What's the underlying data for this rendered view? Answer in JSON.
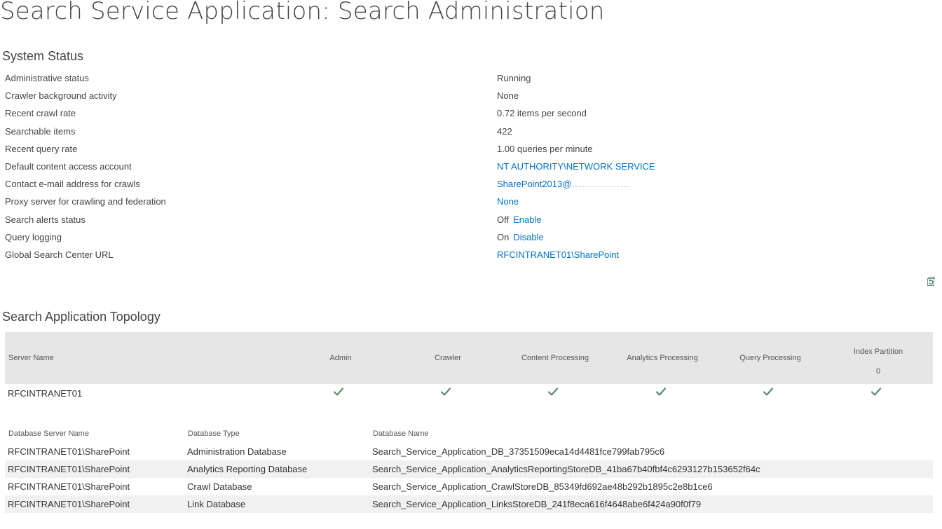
{
  "page": {
    "title": "Search Service Application: Search Administration"
  },
  "system_status": {
    "heading": "System Status",
    "rows": [
      {
        "label": "Administrative status",
        "value": "Running"
      },
      {
        "label": "Crawler background activity",
        "value": "None"
      },
      {
        "label": "Recent crawl rate",
        "value": "0.72 items per second"
      },
      {
        "label": "Searchable items",
        "value": "422"
      },
      {
        "label": "Recent query rate",
        "value": "1.00 queries per minute"
      },
      {
        "label": "Default content access account",
        "link": "NT AUTHORITY\\NETWORK SERVICE"
      },
      {
        "label": "Contact e-mail address for crawls",
        "link": "SharePoint2013@"
      },
      {
        "label": "Proxy server for crawling and federation",
        "link": "None"
      },
      {
        "label": "Search alerts status",
        "value": "Off",
        "link": "Enable"
      },
      {
        "label": "Query logging",
        "value": "On",
        "link": "Disable"
      },
      {
        "label": "Global Search Center URL",
        "link": "RFCINTRANET01\\SharePoint"
      }
    ]
  },
  "topology": {
    "heading": "Search Application Topology",
    "columns": {
      "server_name": "Server Name",
      "admin": "Admin",
      "crawler": "Crawler",
      "content_processing": "Content Processing",
      "analytics_processing": "Analytics Processing",
      "query_processing": "Query Processing",
      "index_partition": "Index Partition",
      "index_partition_number": "0"
    },
    "servers": [
      {
        "name": "RFCINTRANET01"
      }
    ]
  },
  "databases": {
    "columns": {
      "server": "Database Server Name",
      "type": "Database Type",
      "name": "Database Name"
    },
    "rows": [
      {
        "server": "RFCINTRANET01\\SharePoint",
        "type": "Administration Database",
        "name": "Search_Service_Application_DB_37351509eca14d4481fce799fab795c6"
      },
      {
        "server": "RFCINTRANET01\\SharePoint",
        "type": "Analytics Reporting Database",
        "name": "Search_Service_Application_AnalyticsReportingStoreDB_41ba67b40fbf4c6293127b153652f64c"
      },
      {
        "server": "RFCINTRANET01\\SharePoint",
        "type": "Crawl Database",
        "name": "Search_Service_Application_CrawlStoreDB_85349fd692ae48b292b1895c2e8b1ce6"
      },
      {
        "server": "RFCINTRANET01\\SharePoint",
        "type": "Link Database",
        "name": "Search_Service_Application_LinksStoreDB_241f8eca616f4648abe6f424a90f0f79"
      }
    ]
  },
  "colors": {
    "link": "#0072c6",
    "check": "#5a8a6a",
    "header_bg": "#e6e6e6"
  }
}
